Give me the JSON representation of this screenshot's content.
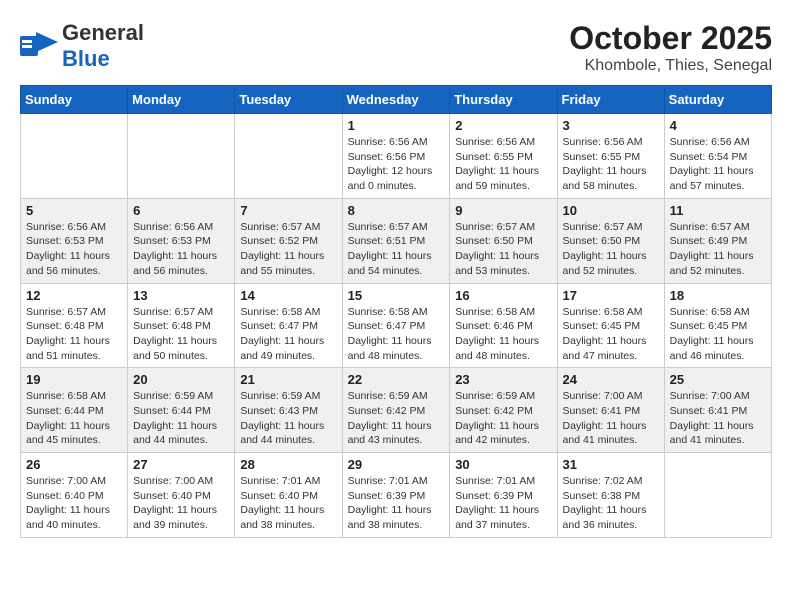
{
  "header": {
    "logo_general": "General",
    "logo_blue": "Blue",
    "title": "October 2025",
    "subtitle": "Khombole, Thies, Senegal"
  },
  "calendar": {
    "weekdays": [
      "Sunday",
      "Monday",
      "Tuesday",
      "Wednesday",
      "Thursday",
      "Friday",
      "Saturday"
    ],
    "weeks": [
      [
        {
          "day": "",
          "info": ""
        },
        {
          "day": "",
          "info": ""
        },
        {
          "day": "",
          "info": ""
        },
        {
          "day": "1",
          "info": "Sunrise: 6:56 AM\nSunset: 6:56 PM\nDaylight: 12 hours\nand 0 minutes."
        },
        {
          "day": "2",
          "info": "Sunrise: 6:56 AM\nSunset: 6:55 PM\nDaylight: 11 hours\nand 59 minutes."
        },
        {
          "day": "3",
          "info": "Sunrise: 6:56 AM\nSunset: 6:55 PM\nDaylight: 11 hours\nand 58 minutes."
        },
        {
          "day": "4",
          "info": "Sunrise: 6:56 AM\nSunset: 6:54 PM\nDaylight: 11 hours\nand 57 minutes."
        }
      ],
      [
        {
          "day": "5",
          "info": "Sunrise: 6:56 AM\nSunset: 6:53 PM\nDaylight: 11 hours\nand 56 minutes."
        },
        {
          "day": "6",
          "info": "Sunrise: 6:56 AM\nSunset: 6:53 PM\nDaylight: 11 hours\nand 56 minutes."
        },
        {
          "day": "7",
          "info": "Sunrise: 6:57 AM\nSunset: 6:52 PM\nDaylight: 11 hours\nand 55 minutes."
        },
        {
          "day": "8",
          "info": "Sunrise: 6:57 AM\nSunset: 6:51 PM\nDaylight: 11 hours\nand 54 minutes."
        },
        {
          "day": "9",
          "info": "Sunrise: 6:57 AM\nSunset: 6:50 PM\nDaylight: 11 hours\nand 53 minutes."
        },
        {
          "day": "10",
          "info": "Sunrise: 6:57 AM\nSunset: 6:50 PM\nDaylight: 11 hours\nand 52 minutes."
        },
        {
          "day": "11",
          "info": "Sunrise: 6:57 AM\nSunset: 6:49 PM\nDaylight: 11 hours\nand 52 minutes."
        }
      ],
      [
        {
          "day": "12",
          "info": "Sunrise: 6:57 AM\nSunset: 6:48 PM\nDaylight: 11 hours\nand 51 minutes."
        },
        {
          "day": "13",
          "info": "Sunrise: 6:57 AM\nSunset: 6:48 PM\nDaylight: 11 hours\nand 50 minutes."
        },
        {
          "day": "14",
          "info": "Sunrise: 6:58 AM\nSunset: 6:47 PM\nDaylight: 11 hours\nand 49 minutes."
        },
        {
          "day": "15",
          "info": "Sunrise: 6:58 AM\nSunset: 6:47 PM\nDaylight: 11 hours\nand 48 minutes."
        },
        {
          "day": "16",
          "info": "Sunrise: 6:58 AM\nSunset: 6:46 PM\nDaylight: 11 hours\nand 48 minutes."
        },
        {
          "day": "17",
          "info": "Sunrise: 6:58 AM\nSunset: 6:45 PM\nDaylight: 11 hours\nand 47 minutes."
        },
        {
          "day": "18",
          "info": "Sunrise: 6:58 AM\nSunset: 6:45 PM\nDaylight: 11 hours\nand 46 minutes."
        }
      ],
      [
        {
          "day": "19",
          "info": "Sunrise: 6:58 AM\nSunset: 6:44 PM\nDaylight: 11 hours\nand 45 minutes."
        },
        {
          "day": "20",
          "info": "Sunrise: 6:59 AM\nSunset: 6:44 PM\nDaylight: 11 hours\nand 44 minutes."
        },
        {
          "day": "21",
          "info": "Sunrise: 6:59 AM\nSunset: 6:43 PM\nDaylight: 11 hours\nand 44 minutes."
        },
        {
          "day": "22",
          "info": "Sunrise: 6:59 AM\nSunset: 6:42 PM\nDaylight: 11 hours\nand 43 minutes."
        },
        {
          "day": "23",
          "info": "Sunrise: 6:59 AM\nSunset: 6:42 PM\nDaylight: 11 hours\nand 42 minutes."
        },
        {
          "day": "24",
          "info": "Sunrise: 7:00 AM\nSunset: 6:41 PM\nDaylight: 11 hours\nand 41 minutes."
        },
        {
          "day": "25",
          "info": "Sunrise: 7:00 AM\nSunset: 6:41 PM\nDaylight: 11 hours\nand 41 minutes."
        }
      ],
      [
        {
          "day": "26",
          "info": "Sunrise: 7:00 AM\nSunset: 6:40 PM\nDaylight: 11 hours\nand 40 minutes."
        },
        {
          "day": "27",
          "info": "Sunrise: 7:00 AM\nSunset: 6:40 PM\nDaylight: 11 hours\nand 39 minutes."
        },
        {
          "day": "28",
          "info": "Sunrise: 7:01 AM\nSunset: 6:40 PM\nDaylight: 11 hours\nand 38 minutes."
        },
        {
          "day": "29",
          "info": "Sunrise: 7:01 AM\nSunset: 6:39 PM\nDaylight: 11 hours\nand 38 minutes."
        },
        {
          "day": "30",
          "info": "Sunrise: 7:01 AM\nSunset: 6:39 PM\nDaylight: 11 hours\nand 37 minutes."
        },
        {
          "day": "31",
          "info": "Sunrise: 7:02 AM\nSunset: 6:38 PM\nDaylight: 11 hours\nand 36 minutes."
        },
        {
          "day": "",
          "info": ""
        }
      ]
    ]
  }
}
